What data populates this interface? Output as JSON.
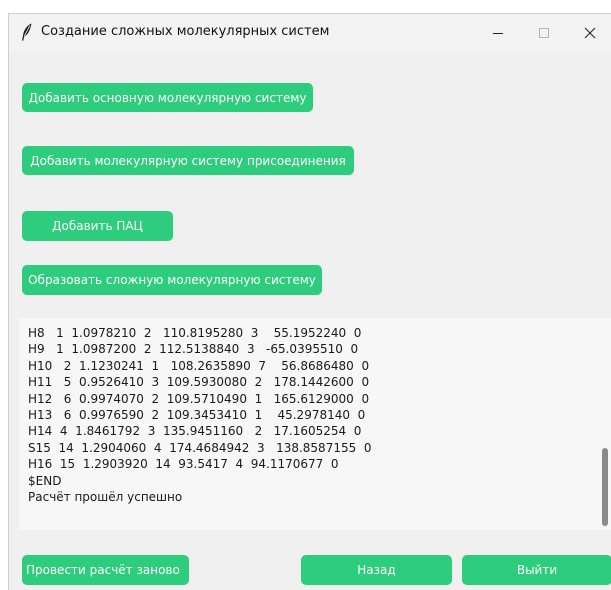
{
  "window": {
    "title": "Создание сложных молекулярных систем"
  },
  "buttons": {
    "add_main": "Добавить основную молекулярную систему",
    "add_attach": "Добавить молекулярную систему присоединения",
    "add_pah": "Добавить ПАЦ",
    "form_complex": "Образовать сложную молекулярную систему",
    "recalc": "Провести расчёт заново",
    "back": "Назад",
    "exit": "Выйти"
  },
  "log": {
    "lines": [
      "H8   1  1.0978210  2   110.8195280  3    55.1952240  0",
      "H9   1  1.0987200  2  112.5138840  3   -65.0395510  0",
      "H10   2  1.1230241  1   108.2635890  7    56.8686480  0",
      "H11   5  0.9526410  3  109.5930080  2   178.1442600  0",
      "H12   6  0.9974070  2  109.5710490  1   165.6129000  0",
      "H13   6  0.9976590  2  109.3453410  1    45.2978140  0",
      "H14  4  1.8461792  3  135.9451160   2   17.1605254  0",
      "S15  14  1.2904060  4  174.4684942  3   138.8587155  0",
      "H16  15  1.2903920  14  93.5417  4  94.1170677  0",
      "$END",
      "Расчёт прошёл успешно"
    ]
  },
  "colors": {
    "accent": "#2ecc7d",
    "window_bg": "#f0f0f0",
    "text_area_bg": "#f7f7f7"
  },
  "icons": {
    "app": "feather-icon",
    "minimize": "minimize-icon",
    "maximize": "maximize-icon",
    "close": "close-icon"
  }
}
